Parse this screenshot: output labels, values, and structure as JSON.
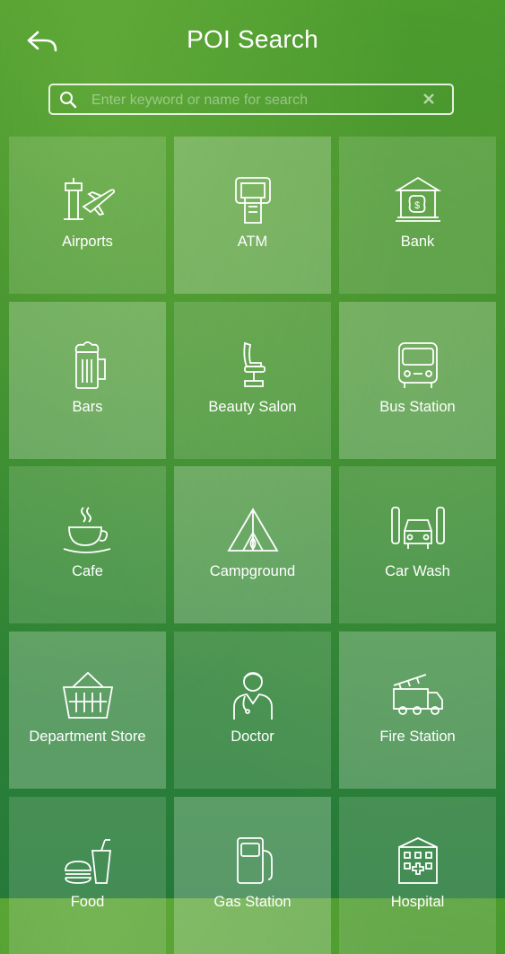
{
  "header": {
    "title": "POI Search"
  },
  "search": {
    "placeholder": "Enter keyword or name for search"
  },
  "tiles": [
    {
      "label": "Airports",
      "icon": "airport-icon"
    },
    {
      "label": "ATM",
      "icon": "atm-icon"
    },
    {
      "label": "Bank",
      "icon": "bank-icon"
    },
    {
      "label": "Bars",
      "icon": "beer-mug-icon"
    },
    {
      "label": "Beauty Salon",
      "icon": "salon-chair-icon"
    },
    {
      "label": "Bus Station",
      "icon": "bus-icon"
    },
    {
      "label": "Cafe",
      "icon": "coffee-cup-icon"
    },
    {
      "label": "Campground",
      "icon": "tent-icon"
    },
    {
      "label": "Car Wash",
      "icon": "car-wash-icon"
    },
    {
      "label": "Department Store",
      "icon": "shopping-basket-icon"
    },
    {
      "label": "Doctor",
      "icon": "doctor-icon"
    },
    {
      "label": "Fire Station",
      "icon": "fire-truck-icon"
    },
    {
      "label": "Food",
      "icon": "fast-food-icon"
    },
    {
      "label": "Gas Station",
      "icon": "gas-pump-icon"
    },
    {
      "label": "Hospital",
      "icon": "hospital-icon"
    }
  ]
}
